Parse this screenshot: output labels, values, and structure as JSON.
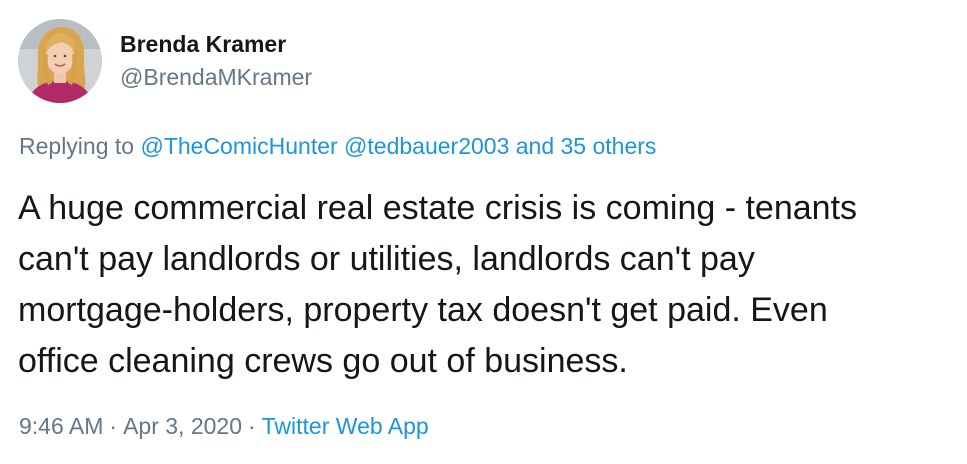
{
  "author": {
    "name": "Brenda Kramer",
    "handle": "@BrendaMKramer"
  },
  "reply": {
    "prefix": "Replying to",
    "mention_1": "@TheComicHunter",
    "mention_2": "@tedbauer2003",
    "others": "and 35 others"
  },
  "tweet": {
    "lines": [
      "A huge commercial real estate crisis is coming - tenants",
      "can't pay landlords or utilities, landlords can't pay",
      "mortgage-holders, property tax doesn't get paid. Even",
      "office cleaning crews go out of business."
    ]
  },
  "meta": {
    "time": "9:46 AM",
    "date": "Apr 3, 2020",
    "separator": "·",
    "source": "Twitter Web App"
  },
  "colors": {
    "text": "#14171a",
    "secondary": "#657786",
    "link": "#1b95e0"
  }
}
